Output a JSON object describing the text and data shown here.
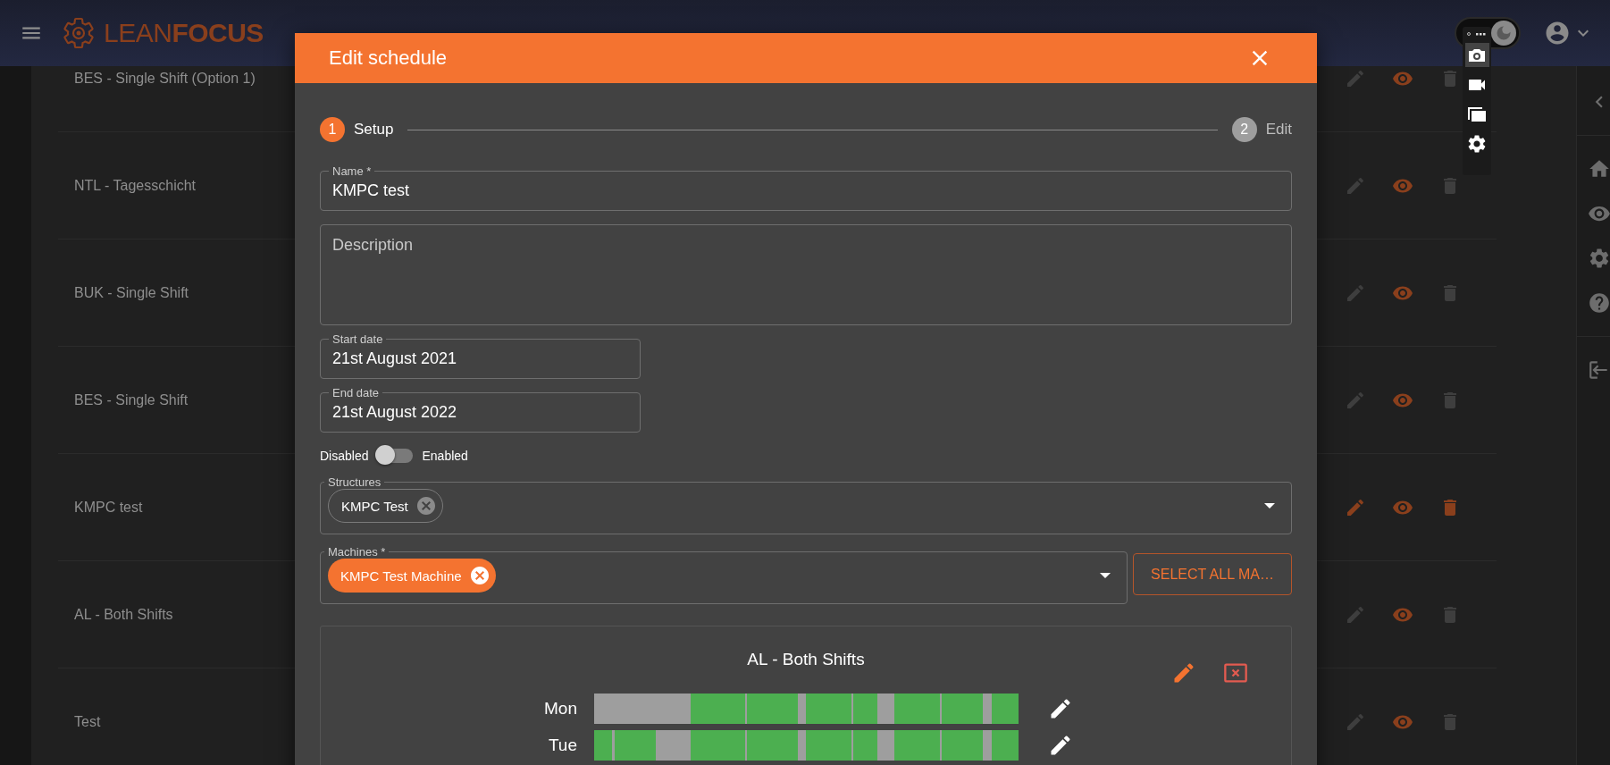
{
  "top_bar": {
    "logo": "LEAN**FOCUS**",
    "theme_toggle": {
      "on": true
    }
  },
  "schedules": [
    {
      "name": "BES - Single Shift (Option 1)",
      "editable": false
    },
    {
      "name": "NTL - Tagesschicht",
      "editable": false
    },
    {
      "name": "BUK - Single Shift",
      "editable": false
    },
    {
      "name": "BES - Single Shift",
      "editable": false
    },
    {
      "name": "KMPC test",
      "editable": true
    },
    {
      "name": "AL - Both Shifts",
      "editable": false
    },
    {
      "name": "Test",
      "editable": false
    }
  ],
  "dialog": {
    "title": "Edit schedule",
    "steps": [
      {
        "number": "1",
        "label": "Setup",
        "selected": true
      },
      {
        "number": "2",
        "label": "Edit",
        "selected": false
      }
    ],
    "name_field": {
      "label": "Name *",
      "value": "KMPC test"
    },
    "description_field": {
      "placeholder": "Description"
    },
    "start_date": {
      "label": "Start date",
      "value": "21st August 2021"
    },
    "end_date": {
      "label": "End date",
      "value": "21st August 2022"
    },
    "status_toggle": {
      "off_label": "Disabled",
      "on_label": "Enabled",
      "on": false
    },
    "structures": {
      "label": "Structures",
      "kind": "outlined",
      "chips": [
        {
          "label": "KMPC Test"
        }
      ]
    },
    "machines": {
      "label": "Machines *",
      "kind": "filled",
      "chips": [
        {
          "label": "KMPC Test Machine"
        }
      ]
    },
    "select_all_button": "SELECT ALL MA…",
    "schedule_card": {
      "title": "AL - Both Shifts",
      "days": [
        {
          "label": "Mon"
        },
        {
          "label": "Tue"
        }
      ]
    }
  },
  "capture_toolbar": {
    "items": [
      {
        "kind": "camera",
        "selected": true
      },
      {
        "kind": "video",
        "selected": false
      },
      {
        "kind": "windows",
        "selected": false
      },
      {
        "kind": "settings",
        "selected": false
      }
    ]
  }
}
